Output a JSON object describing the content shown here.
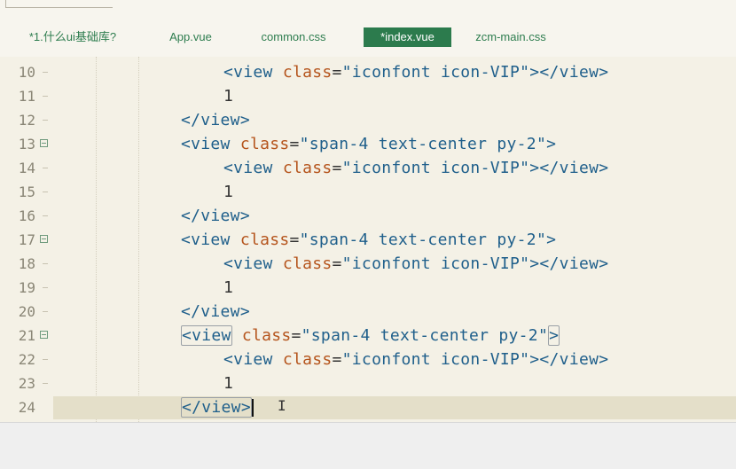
{
  "tabs": [
    {
      "label": "*1.什么ui基础库?",
      "active": false
    },
    {
      "label": "App.vue",
      "active": false
    },
    {
      "label": "common.css",
      "active": false
    },
    {
      "label": "*index.vue",
      "active": true
    },
    {
      "label": "zcm-main.css",
      "active": false
    }
  ],
  "editor": {
    "current_line": "24",
    "lines": [
      {
        "num": "10",
        "open": "<view",
        "attr": "class",
        "eq": "=",
        "val": "\"iconfont icon-VIP\"",
        "close": "></view>"
      },
      {
        "num": "11",
        "text": "1"
      },
      {
        "num": "12",
        "close": "</view>"
      },
      {
        "num": "13",
        "open": "<view",
        "attr": "class",
        "eq": "=",
        "val": "\"span-4 text-center py-2\"",
        "close": ">"
      },
      {
        "num": "14",
        "open": "<view",
        "attr": "class",
        "eq": "=",
        "val": "\"iconfont icon-VIP\"",
        "close": "></view>"
      },
      {
        "num": "15",
        "text": "1"
      },
      {
        "num": "16",
        "close": "</view>"
      },
      {
        "num": "17",
        "open": "<view",
        "attr": "class",
        "eq": "=",
        "val": "\"span-4 text-center py-2\"",
        "close": ">"
      },
      {
        "num": "18",
        "open": "<view",
        "attr": "class",
        "eq": "=",
        "val": "\"iconfont icon-VIP\"",
        "close": "></view>"
      },
      {
        "num": "19",
        "text": "1"
      },
      {
        "num": "20",
        "close": "</view>"
      },
      {
        "num": "21",
        "open": "<view",
        "attr": "class",
        "eq": "=",
        "val": "\"span-4 text-center py-2\"",
        "close": ">"
      },
      {
        "num": "22",
        "open": "<view",
        "attr": "class",
        "eq": "=",
        "val": "\"iconfont icon-VIP\"",
        "close": "></view>"
      },
      {
        "num": "23",
        "text": "1"
      },
      {
        "num": "24",
        "close": "</view>"
      }
    ]
  },
  "colors": {
    "tab_active_bg": "#2c7b4d",
    "tab_text": "#2e7d4f",
    "tag": "#1f5f8b",
    "attribute": "#b5541c",
    "current_line_bg": "#e4dfc9"
  }
}
